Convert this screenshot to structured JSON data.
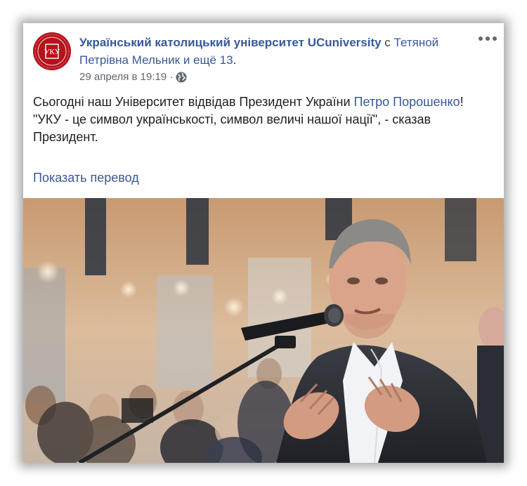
{
  "post": {
    "page_name": "Український католицький університет UCuniversity",
    "with_word": "с",
    "tagged_person": "Тетяной Петрівна Мельник",
    "and_more": "и ещё 13",
    "period": ".",
    "timestamp": "29 апреля в 19:19",
    "separator": "·",
    "privacy_icon": "globe-icon",
    "more_icon": "more-options-icon",
    "text_line1_prefix": "Сьогодні наш Університет відвідав Президент України ",
    "mention": "Петро Порошенко",
    "text_line1_suffix": "!",
    "text_quote": "\"УКУ - це символ українськості, символ величі нашої нації\", - сказав Президент.",
    "translate_label": "Показать перевод"
  },
  "avatar": {
    "logo_text": "УКУ",
    "ring_text": "УКРАЇНСЬКИЙ КАТОЛИЦЬКИЙ УНІВЕРСИТЕТ"
  },
  "colors": {
    "link": "#385898",
    "brand_red": "#b5121b",
    "text": "#1c1e21",
    "meta": "#616770"
  }
}
